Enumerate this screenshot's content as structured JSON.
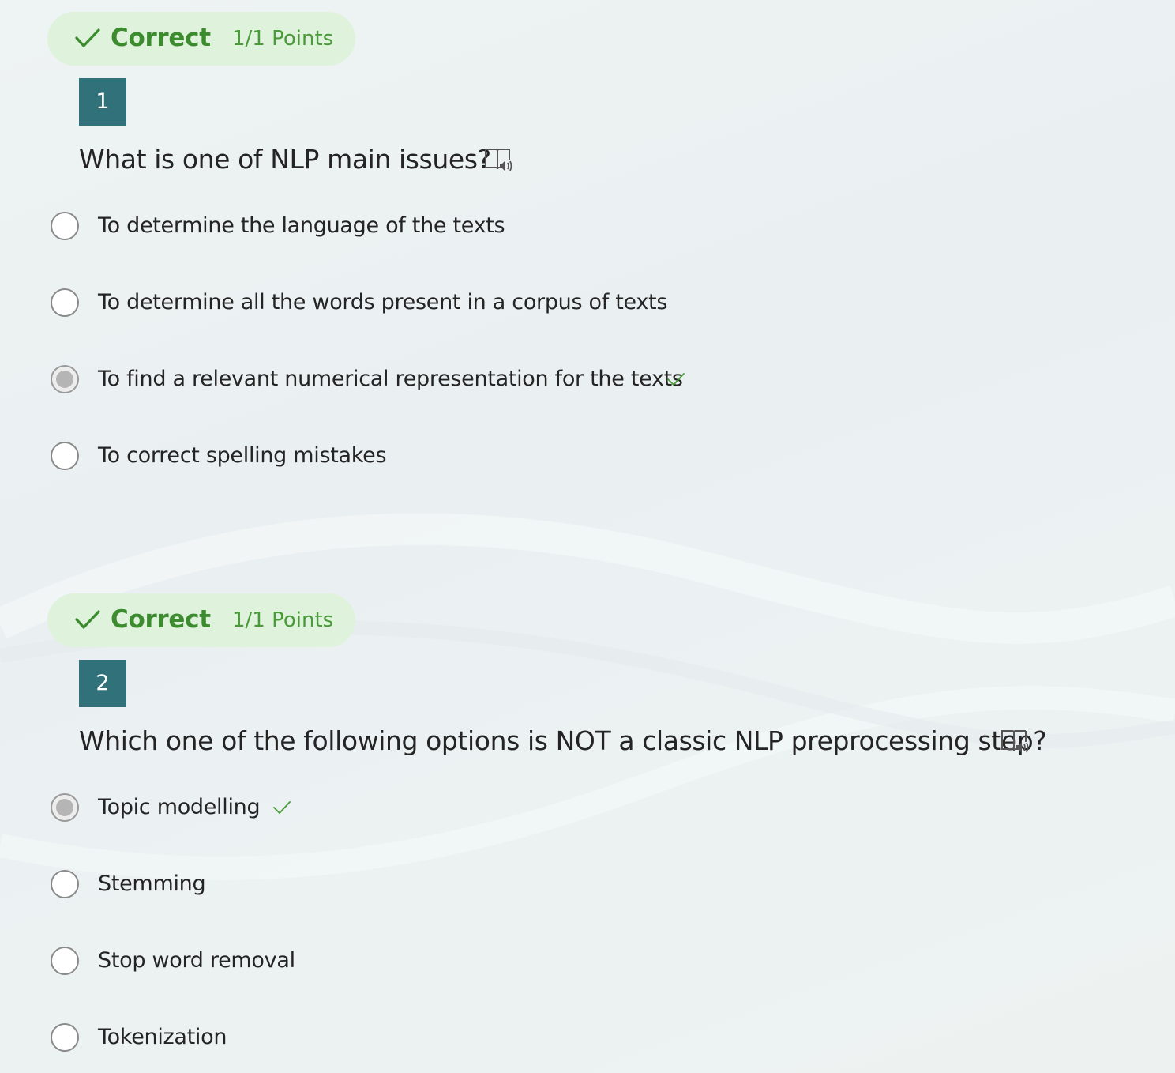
{
  "colors": {
    "badge_background": "#def2dc",
    "correct_text": "#3d8b2f",
    "number_background": "#31727a"
  },
  "questions": [
    {
      "badge": {
        "status": "Correct",
        "points": "1/1 Points",
        "icon": "check-icon"
      },
      "number": "1",
      "title": "What is one of NLP main issues?",
      "reader_icon": "immersive-reader-icon",
      "options": [
        {
          "label": "To determine the language of the texts",
          "selected": false,
          "correct": false
        },
        {
          "label": "To determine all the words present in a corpus of texts",
          "selected": false,
          "correct": false
        },
        {
          "label": "To find a relevant numerical representation for the texts",
          "selected": true,
          "correct": true
        },
        {
          "label": "To correct spelling mistakes",
          "selected": false,
          "correct": false
        }
      ]
    },
    {
      "badge": {
        "status": "Correct",
        "points": "1/1 Points",
        "icon": "check-icon"
      },
      "number": "2",
      "title": "Which one of the following options is NOT a classic NLP preprocessing step?",
      "reader_icon": "immersive-reader-icon",
      "options": [
        {
          "label": "Topic modelling",
          "selected": true,
          "correct": true
        },
        {
          "label": "Stemming",
          "selected": false,
          "correct": false
        },
        {
          "label": "Stop word removal",
          "selected": false,
          "correct": false
        },
        {
          "label": "Tokenization",
          "selected": false,
          "correct": false
        }
      ]
    }
  ]
}
